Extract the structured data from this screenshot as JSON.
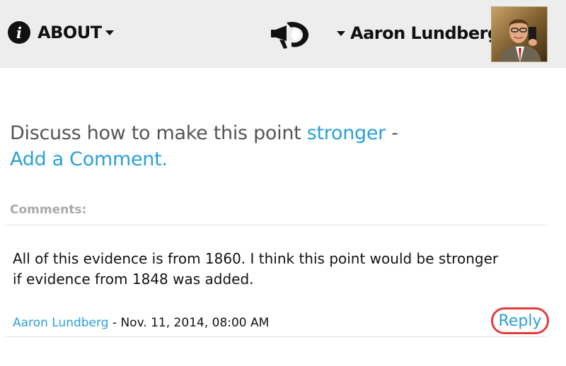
{
  "header": {
    "about_label": "ABOUT",
    "user_name": "Aaron Lundberg",
    "icons": [
      "info-icon",
      "chevron-down-icon",
      "megaphone-logo-icon",
      "chevron-down-icon",
      "avatar"
    ]
  },
  "prompt": {
    "text_before": "Discuss how to make this point ",
    "stronger_link": "stronger",
    "separator": " -",
    "add_comment_link": "Add a Comment."
  },
  "comments": {
    "heading": "Comments:",
    "items": [
      {
        "text": "All of this evidence is from 1860.  I think this point would be stronger if evidence from 1848 was added.",
        "author": "Aaron Lundberg",
        "separator": " - ",
        "timestamp": "Nov. 11, 2014, 08:00 AM",
        "reply_label": "Reply"
      }
    ]
  },
  "colors": {
    "link": "#2aa0d8",
    "topbar": "#ededed",
    "reply_highlight": "#e33b3b"
  }
}
